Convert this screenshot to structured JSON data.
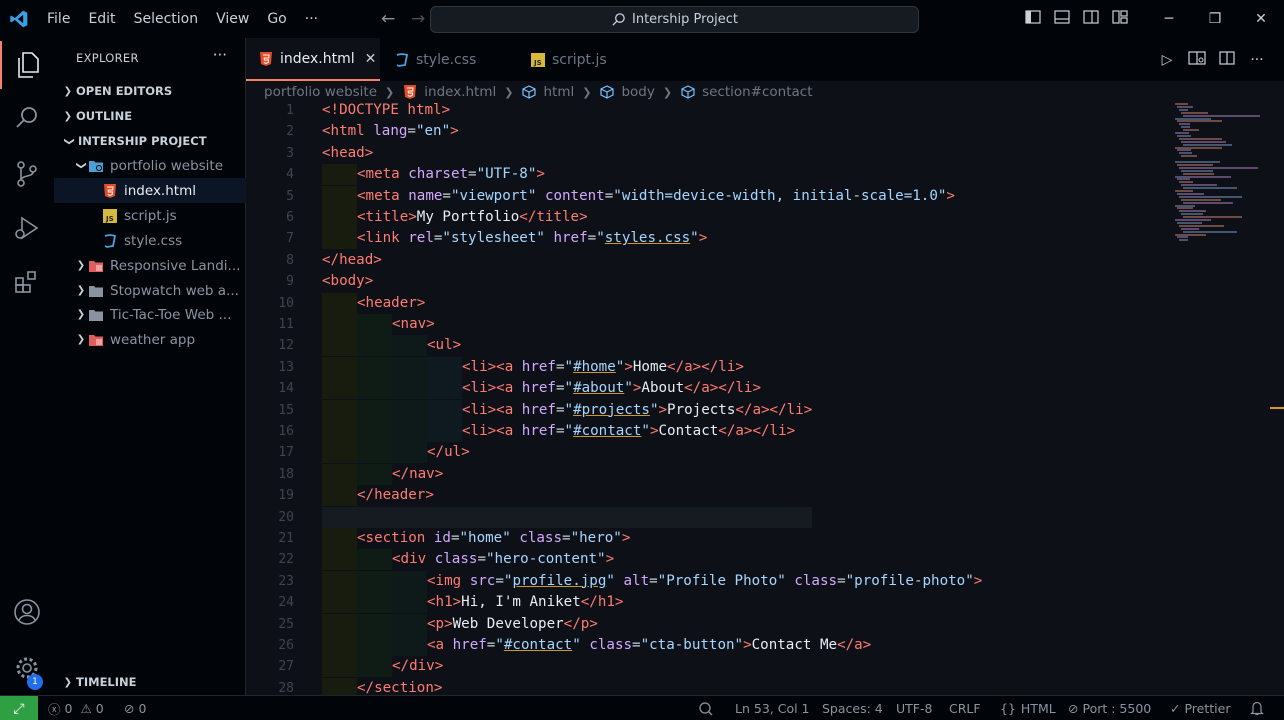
{
  "titlebar": {
    "menus": [
      "File",
      "Edit",
      "Selection",
      "View",
      "Go"
    ],
    "more": "···",
    "search_text": "Intership Project"
  },
  "sidebar": {
    "title": "EXPLORER",
    "more": "···",
    "sections": {
      "open_editors": "OPEN EDITORS",
      "outline": "OUTLINE",
      "project": "INTERSHIP PROJECT",
      "timeline": "TIMELINE"
    },
    "tree": [
      {
        "label": "portfolio website",
        "kind": "folder-open"
      },
      {
        "label": "index.html",
        "kind": "html",
        "selected": true
      },
      {
        "label": "script.js",
        "kind": "js"
      },
      {
        "label": "style.css",
        "kind": "css"
      },
      {
        "label": "Responsive Landi...",
        "kind": "folder"
      },
      {
        "label": "Stopwatch web a...",
        "kind": "folder"
      },
      {
        "label": "Tic-Tac-Toe Web ...",
        "kind": "folder"
      },
      {
        "label": "weather app",
        "kind": "folder"
      }
    ]
  },
  "activity": {
    "settings_badge": "1"
  },
  "tabs": [
    {
      "label": "index.html",
      "active": true
    },
    {
      "label": "style.css"
    },
    {
      "label": "script.js"
    }
  ],
  "breadcrumb": [
    "portfolio website",
    "index.html",
    "html",
    "body",
    "section#contact"
  ],
  "editor": {
    "lines": [
      {
        "n": "1",
        "tokens": [
          [
            "t",
            "<!DOCTYPE html>"
          ]
        ]
      },
      {
        "n": "2",
        "tokens": [
          [
            "t",
            "<html "
          ],
          [
            "a",
            "lang"
          ],
          [
            "p",
            "="
          ],
          [
            "s",
            "\"en\""
          ],
          [
            "t",
            ">"
          ]
        ]
      },
      {
        "n": "3",
        "tokens": [
          [
            "t",
            "<head>"
          ]
        ]
      },
      {
        "n": "4",
        "tokens": [
          [
            "t",
            "<meta "
          ],
          [
            "a",
            "charset"
          ],
          [
            "p",
            "="
          ],
          [
            "s",
            "\"UTF-8\""
          ],
          [
            "t",
            ">"
          ]
        ]
      },
      {
        "n": "5",
        "tokens": [
          [
            "t",
            "<meta "
          ],
          [
            "a",
            "name"
          ],
          [
            "p",
            "="
          ],
          [
            "s",
            "\"viewport\" "
          ],
          [
            "a",
            "content"
          ],
          [
            "p",
            "="
          ],
          [
            "s",
            "\"width=device-width, initial-scale=1.0\""
          ],
          [
            "t",
            ">"
          ]
        ]
      },
      {
        "n": "6",
        "tokens": [
          [
            "t",
            "<title>"
          ],
          [
            "x",
            "My Portfolio"
          ],
          [
            "t",
            "</title>"
          ]
        ]
      },
      {
        "n": "7",
        "tokens": [
          [
            "t",
            "<link "
          ],
          [
            "a",
            "rel"
          ],
          [
            "p",
            "="
          ],
          [
            "s",
            "\"stylesheet\" "
          ],
          [
            "a",
            "href"
          ],
          [
            "p",
            "="
          ],
          [
            "s",
            "\""
          ],
          [
            "l",
            "styles.css"
          ],
          [
            "s",
            "\""
          ],
          [
            "t",
            ">"
          ]
        ]
      },
      {
        "n": "8",
        "tokens": [
          [
            "t",
            "</head>"
          ]
        ]
      },
      {
        "n": "9",
        "tokens": [
          [
            "t",
            "<body>"
          ]
        ]
      },
      {
        "n": "10",
        "tokens": [
          [
            "t",
            "<header>"
          ]
        ]
      },
      {
        "n": "11",
        "tokens": [
          [
            "t",
            "<nav>"
          ]
        ]
      },
      {
        "n": "12",
        "tokens": [
          [
            "t",
            "<ul>"
          ]
        ]
      },
      {
        "n": "13",
        "tokens": [
          [
            "t",
            "<li><a "
          ],
          [
            "a",
            "href"
          ],
          [
            "p",
            "="
          ],
          [
            "s",
            "\""
          ],
          [
            "l",
            "#home"
          ],
          [
            "s",
            "\""
          ],
          [
            "t",
            ">"
          ],
          [
            "x",
            "Home"
          ],
          [
            "t",
            "</a></li>"
          ]
        ]
      },
      {
        "n": "14",
        "tokens": [
          [
            "t",
            "<li><a "
          ],
          [
            "a",
            "href"
          ],
          [
            "p",
            "="
          ],
          [
            "s",
            "\""
          ],
          [
            "l",
            "#about"
          ],
          [
            "s",
            "\""
          ],
          [
            "t",
            ">"
          ],
          [
            "x",
            "About"
          ],
          [
            "t",
            "</a></li>"
          ]
        ]
      },
      {
        "n": "15",
        "tokens": [
          [
            "t",
            "<li><a "
          ],
          [
            "a",
            "href"
          ],
          [
            "p",
            "="
          ],
          [
            "s",
            "\""
          ],
          [
            "l",
            "#projects"
          ],
          [
            "s",
            "\""
          ],
          [
            "t",
            ">"
          ],
          [
            "x",
            "Projects"
          ],
          [
            "t",
            "</a></li>"
          ]
        ]
      },
      {
        "n": "16",
        "tokens": [
          [
            "t",
            "<li><a "
          ],
          [
            "a",
            "href"
          ],
          [
            "p",
            "="
          ],
          [
            "s",
            "\""
          ],
          [
            "l",
            "#contact"
          ],
          [
            "s",
            "\""
          ],
          [
            "t",
            ">"
          ],
          [
            "x",
            "Contact"
          ],
          [
            "t",
            "</a></li>"
          ]
        ]
      },
      {
        "n": "17",
        "tokens": [
          [
            "t",
            "</ul>"
          ]
        ]
      },
      {
        "n": "18",
        "tokens": [
          [
            "t",
            "</nav>"
          ]
        ]
      },
      {
        "n": "19",
        "tokens": [
          [
            "t",
            "</header>"
          ]
        ]
      },
      {
        "n": "20",
        "tokens": []
      },
      {
        "n": "21",
        "tokens": [
          [
            "t",
            "<section "
          ],
          [
            "a",
            "id"
          ],
          [
            "p",
            "="
          ],
          [
            "s",
            "\"home\" "
          ],
          [
            "a",
            "class"
          ],
          [
            "p",
            "="
          ],
          [
            "s",
            "\"hero\""
          ],
          [
            "t",
            ">"
          ]
        ]
      },
      {
        "n": "22",
        "tokens": [
          [
            "t",
            "<div "
          ],
          [
            "a",
            "class"
          ],
          [
            "p",
            "="
          ],
          [
            "s",
            "\"hero-content\""
          ],
          [
            "t",
            ">"
          ]
        ]
      },
      {
        "n": "23",
        "tokens": [
          [
            "t",
            "<img "
          ],
          [
            "a",
            "src"
          ],
          [
            "p",
            "="
          ],
          [
            "s",
            "\""
          ],
          [
            "l",
            "profile.jpg"
          ],
          [
            "s",
            "\" "
          ],
          [
            "a",
            "alt"
          ],
          [
            "p",
            "="
          ],
          [
            "s",
            "\"Profile Photo\" "
          ],
          [
            "a",
            "class"
          ],
          [
            "p",
            "="
          ],
          [
            "s",
            "\"profile-photo\""
          ],
          [
            "t",
            ">"
          ]
        ]
      },
      {
        "n": "24",
        "tokens": [
          [
            "t",
            "<h1>"
          ],
          [
            "x",
            "Hi, I'm Aniket"
          ],
          [
            "t",
            "</h1>"
          ]
        ]
      },
      {
        "n": "25",
        "tokens": [
          [
            "t",
            "<p>"
          ],
          [
            "x",
            "Web Developer"
          ],
          [
            "t",
            "</p>"
          ]
        ]
      },
      {
        "n": "26",
        "tokens": [
          [
            "t",
            "<a "
          ],
          [
            "a",
            "href"
          ],
          [
            "p",
            "="
          ],
          [
            "s",
            "\""
          ],
          [
            "l",
            "#contact"
          ],
          [
            "s",
            "\" "
          ],
          [
            "a",
            "class"
          ],
          [
            "p",
            "="
          ],
          [
            "s",
            "\"cta-button\""
          ],
          [
            "t",
            ">"
          ],
          [
            "x",
            "Contact Me"
          ],
          [
            "t",
            "</a>"
          ]
        ]
      },
      {
        "n": "27",
        "tokens": [
          [
            "t",
            "</div>"
          ]
        ]
      },
      {
        "n": "28",
        "tokens": [
          [
            "t",
            "</section>"
          ]
        ]
      }
    ]
  },
  "statusbar": {
    "errors": "0",
    "warnings": "0",
    "ports": "0",
    "position": "Ln 53, Col 1",
    "spaces": "Spaces: 4",
    "encoding": "UTF-8",
    "eol": "CRLF",
    "language": "HTML",
    "port": "Port : 5500",
    "prettier": "Prettier"
  },
  "colors": {
    "accent": "#f78166",
    "remote": "#2ea043",
    "tag": "#ff7b72",
    "attr": "#d2a8ff",
    "string": "#a5d6ff"
  }
}
